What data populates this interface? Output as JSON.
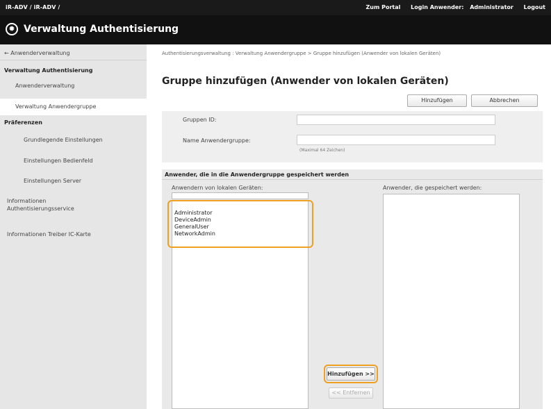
{
  "topbar": {
    "device_path": "iR-ADV /  iR-ADV /",
    "portal_link": "Zum Portal",
    "login_label": "Login Anwender:",
    "login_user": "Administrator",
    "logout": "Logout"
  },
  "titlebar": {
    "title": "Verwaltung Authentisierung",
    "logo_icon": "gear-icon"
  },
  "sidebar": {
    "back_link": "← Anwenderverwaltung",
    "section_auth": "Verwaltung Authentisierung",
    "item_user_mgmt": "Anwenderverwaltung",
    "item_group_mgmt": "Verwaltung Anwendergruppe",
    "section_prefs": "Präferenzen",
    "item_basic": "Grundlegende Einstellungen",
    "item_panel": "Einstellungen Bedienfeld",
    "item_server": "Einstellungen Server",
    "item_auth_service": "Informationen Authentisierungsservice",
    "item_ic_card": "Informationen Treiber IC-Karte"
  },
  "main": {
    "breadcrumb": "Authentisierungsverwaltung : Verwaltung Anwendergruppe > Gruppe hinzufügen (Anwender von lokalen Geräten)",
    "page_title": "Gruppe hinzufügen (Anwender von lokalen Geräten)",
    "add_button": "Hinzufügen",
    "cancel_button": "Abbrechen",
    "group_id_label": "Gruppen ID:",
    "group_id_value": "",
    "group_name_label": "Name Anwendergruppe:",
    "group_name_value": "",
    "group_name_hint": "(Maximal 64 Zeichen)",
    "members_heading": "Anwender, die in die Anwendergruppe gespeichert werden",
    "local_users_label": "Anwendern von lokalen Geräten:",
    "local_users_filter": "",
    "local_users": [
      "Administrator",
      "DeviceAdmin",
      "GeneralUser",
      "NetworkAdmin"
    ],
    "saved_users_label": "Anwender, die gespeichert werden:",
    "saved_users": [],
    "move_add_button": "Hinzufügen >>",
    "move_remove_button": "<< Entfernen"
  },
  "colors": {
    "topbar_bg": "#1a1a1a",
    "sidebar_bg": "#e6e6e6",
    "highlight": "#f0a020"
  }
}
